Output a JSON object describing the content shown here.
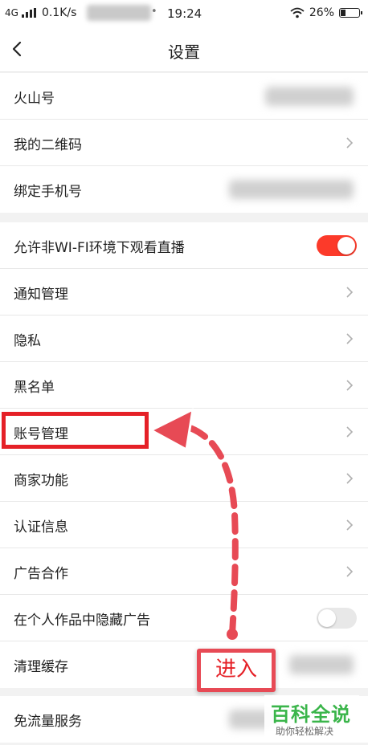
{
  "status_bar": {
    "network": "4G",
    "speed": "0.1K/s",
    "dot": "•",
    "time": "19:24",
    "battery": "26%",
    "icons": [
      "signal-icon",
      "wifi-icon",
      "battery-icon"
    ]
  },
  "nav": {
    "title": "设置",
    "back_icon": "chevron-left-icon"
  },
  "groups": [
    {
      "items": [
        {
          "label": "火山号",
          "accessory": "blurred-value"
        },
        {
          "label": "我的二维码",
          "accessory": "chevron"
        },
        {
          "label": "绑定手机号",
          "accessory": "blurred-value"
        }
      ]
    },
    {
      "items": [
        {
          "label": "允许非WI-FI环境下观看直播",
          "accessory": "toggle",
          "toggle_on": true
        },
        {
          "label": "通知管理",
          "accessory": "chevron"
        },
        {
          "label": "隐私",
          "accessory": "chevron"
        },
        {
          "label": "黑名单",
          "accessory": "chevron"
        },
        {
          "label": "账号管理",
          "accessory": "chevron"
        },
        {
          "label": "商家功能",
          "accessory": "chevron"
        },
        {
          "label": "认证信息",
          "accessory": "chevron"
        },
        {
          "label": "广告合作",
          "accessory": "chevron"
        },
        {
          "label": "在个人作品中隐藏广告",
          "accessory": "toggle",
          "toggle_on": false
        },
        {
          "label": "清理缓存",
          "accessory": "blurred-value"
        }
      ]
    },
    {
      "items": [
        {
          "label": "免流量服务",
          "accessory": "blurred-value"
        }
      ]
    }
  ],
  "annotation": {
    "badge_text": "进入",
    "color": "#e52027"
  },
  "watermark": {
    "main": "百科全说",
    "sub": "助你轻松解决",
    "color": "#3ab54a"
  },
  "colors": {
    "toggle_on": "#fc3a2a",
    "toggle_off": "#e8e8e8",
    "background": "#f2f2f2"
  }
}
